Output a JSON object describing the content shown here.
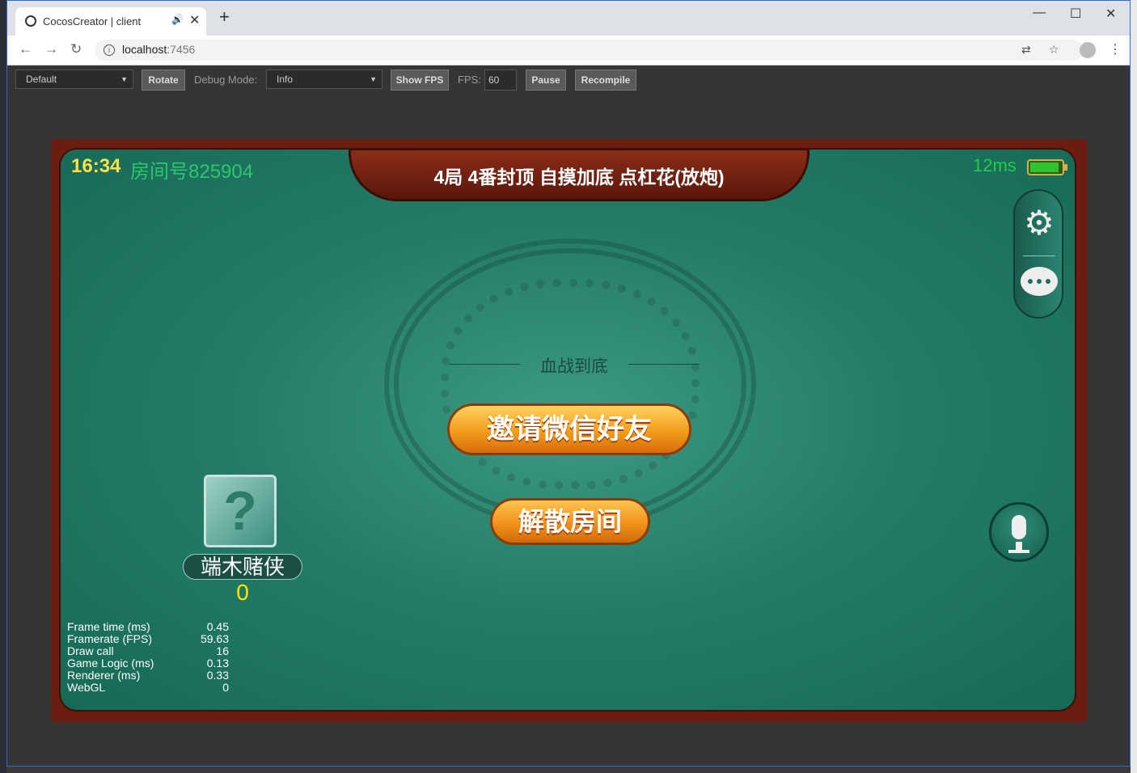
{
  "browser": {
    "tab_title": "CocosCreator | client",
    "url_host": "localhost",
    "url_port": ":7456",
    "win_min": "—",
    "win_max": "☐",
    "win_close": "✕"
  },
  "toolbar": {
    "device_select": "Default",
    "rotate": "Rotate",
    "debug_mode_label": "Debug Mode:",
    "debug_mode_value": "Info",
    "show_fps": "Show FPS",
    "fps_label": "FPS:",
    "fps_value": "60",
    "pause": "Pause",
    "recompile": "Recompile"
  },
  "game": {
    "clock": "16:34",
    "room_number": "房间号825904",
    "rules": "4局 4番封顶 自摸加底 点杠花(放炮)",
    "ping": "12ms",
    "battery_level": 0.92,
    "mode": "血战到底",
    "invite_button": "邀请微信好友",
    "dissolve_button": "解散房间",
    "player": {
      "name": "端木赌侠",
      "score": "0"
    },
    "icons": {
      "settings": "gear-icon",
      "chat": "chat-icon",
      "voice": "microphone-icon"
    }
  },
  "stats": [
    {
      "label": "Frame time (ms)",
      "value": "0.45"
    },
    {
      "label": "Framerate (FPS)",
      "value": "59.63"
    },
    {
      "label": "Draw call",
      "value": "16"
    },
    {
      "label": "Game Logic (ms)",
      "value": "0.13"
    },
    {
      "label": "Renderer (ms)",
      "value": "0.33"
    },
    {
      "label": "WebGL",
      "value": "0"
    }
  ]
}
